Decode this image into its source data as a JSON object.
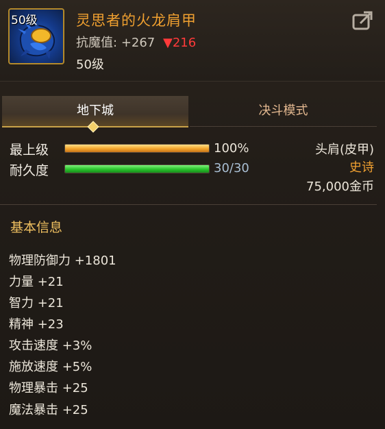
{
  "item": {
    "icon_level": "50级",
    "name": "灵思者的火龙肩甲",
    "resist_label": "抗魔值:",
    "resist_value": "+267",
    "resist_drop": "▼216",
    "level_text": "50级"
  },
  "tabs": [
    {
      "label": "地下城",
      "active": true
    },
    {
      "label": "决斗模式",
      "active": false
    }
  ],
  "bars": [
    {
      "label": "最上级",
      "fill": 1.0,
      "value": "100%",
      "color": "#f3a52a"
    },
    {
      "label": "耐久度",
      "fill": 1.0,
      "value": "30/30",
      "color": "#2ac42c"
    }
  ],
  "meta": {
    "slot": "头肩(皮甲)",
    "rarity": "史诗",
    "price": "75,000金币"
  },
  "section_title": "基本信息",
  "attributes": [
    "物理防御力 +1801",
    "力量 +21",
    "智力 +21",
    "精神 +23",
    "攻击速度 +3%",
    "施放速度 +5%",
    "物理暴击 +25",
    "魔法暴击 +25"
  ],
  "colors": {
    "title": "#f0a030",
    "rarity": "#f0a030",
    "drop": "#ff3a3a",
    "accent": "#c9a24a"
  },
  "icons": {
    "share": "share-icon",
    "item": "dragon-shoulder-icon"
  }
}
